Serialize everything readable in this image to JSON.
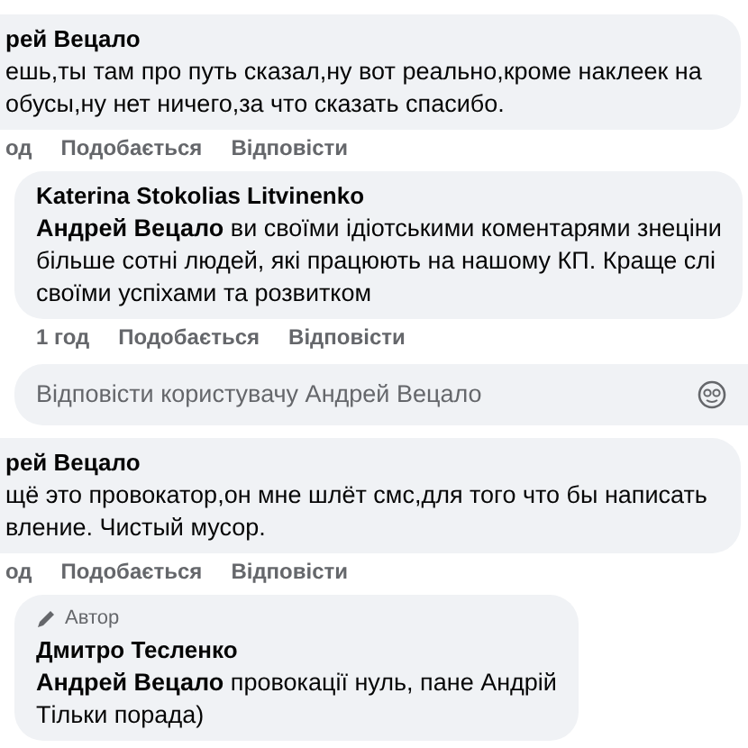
{
  "comments": [
    {
      "kind": "comment",
      "author": "рей Вецало",
      "lines": [
        "ешь,ты там про путь сказал,ну вот реально,кроме наклеек на",
        "обусы,ну нет ничего,за что сказать спасибо."
      ],
      "actions": [
        "од",
        "Подобається",
        "Відповісти"
      ]
    },
    {
      "kind": "reply",
      "author": "Katerina Stokolias Litvinenko",
      "mention": "Андрей Вецало",
      "lines": [
        "ви своїми ідіотськими коментарями знеціни",
        "більше сотні людей, які працюють на нашому КП. Краще слі",
        "своїми успіхами та розвитком"
      ],
      "actions": [
        "1 год",
        "Подобається",
        "Відповісти"
      ]
    },
    {
      "kind": "reply_field",
      "placeholder": "Відповісти користувачу Андрей Вецало"
    },
    {
      "kind": "comment",
      "author": "рей Вецало",
      "lines": [
        "щё это провокатор,он мне шлёт смс,для того что бы написать",
        "вление. Чистый мусор."
      ],
      "actions": [
        "од",
        "Подобається",
        "Відповісти"
      ]
    },
    {
      "kind": "reply",
      "author_badge": "Автор",
      "author": "Дмитро Тесленко",
      "mention": "Андрей Вецало",
      "lines": [
        "провокації нуль, пане Андрій",
        "Тільки порада)"
      ]
    }
  ]
}
